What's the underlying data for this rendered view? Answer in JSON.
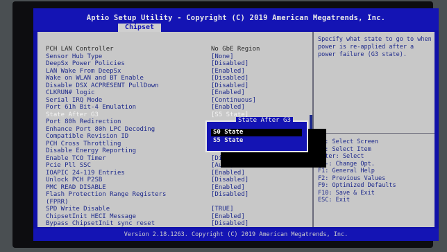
{
  "header": {
    "title": "Aptio Setup Utility - Copyright (C) 2019 American Megatrends, Inc.",
    "tab": "Chipset"
  },
  "settings": [
    {
      "label": "PCH LAN Controller",
      "value": "No GbE Region",
      "style": "dark"
    },
    {
      "label": "Sensor Hub Type",
      "value": "[None]",
      "style": "blue"
    },
    {
      "label": "DeepSx Power Policies",
      "value": "[Disabled]",
      "style": "blue"
    },
    {
      "label": "LAN Wake From DeepSx",
      "value": "[Enabled]",
      "style": "blue"
    },
    {
      "label": "Wake on WLAN and BT Enable",
      "value": "[Disabled]",
      "style": "blue"
    },
    {
      "label": "Disable DSX ACPRESENT PullDown",
      "value": "[Disabled]",
      "style": "blue"
    },
    {
      "label": "CLKRUN# logic",
      "value": "[Enabled]",
      "style": "blue"
    },
    {
      "label": "Serial IRQ Mode",
      "value": "[Continuous]",
      "style": "blue"
    },
    {
      "label": "Port 61h Bit-4 Emulation",
      "value": "[Enabled]",
      "style": "blue"
    },
    {
      "label": "State After G3",
      "value": "[S5 State]",
      "style": "white"
    },
    {
      "label": "Port 80h Redirection",
      "value": "",
      "style": "blue"
    },
    {
      "label": "Enhance Port 80h LPC Decoding",
      "value": "",
      "style": "blue"
    },
    {
      "label": "Compatible Revision ID",
      "value": "",
      "style": "blue"
    },
    {
      "label": "PCH Cross Throttling",
      "value": "",
      "style": "blue"
    },
    {
      "label": "Disable Energy Reporting",
      "value": "",
      "style": "blue"
    },
    {
      "label": "Enable TCO Timer",
      "value": "[Disabled]",
      "style": "blue"
    },
    {
      "label": "Pcie Pll SSC",
      "value": "[Auto]",
      "style": "blue"
    },
    {
      "label": "IOAPIC 24-119 Entries",
      "value": "[Enabled]",
      "style": "blue"
    },
    {
      "label": "Unlock PCH P2SB",
      "value": "[Disabled]",
      "style": "blue"
    },
    {
      "label": "PMC READ DISABLE",
      "value": "[Enabled]",
      "style": "blue"
    },
    {
      "label": "Flash Protection Range Registers",
      "value": "[Disabled]",
      "style": "blue"
    },
    {
      "label": "(FPRR)",
      "value": "",
      "style": "blue"
    },
    {
      "label": "SPD Write Disable",
      "value": "[TRUE]",
      "style": "blue"
    },
    {
      "label": "ChipsetInit HECI Message",
      "value": "[Enabled]",
      "style": "blue"
    },
    {
      "label": "Bypass ChipsetInit sync reset",
      "value": "[Disabled]",
      "style": "blue"
    }
  ],
  "help_text": "Specify what state to go to when power is re-applied after a power failure (G3 state).",
  "keys": [
    "→←: Select Screen",
    "↑↓: Select Item",
    "Enter: Select",
    "+/-: Change Opt.",
    "F1: General Help",
    "F2: Previous Values",
    "F9: Optimized Defaults",
    "F10: Save & Exit",
    "ESC: Exit"
  ],
  "popup": {
    "title": "State After G3",
    "options": [
      "S0 State",
      "S5 State"
    ],
    "selected_index": 0
  },
  "footer": "Version 2.18.1263. Copyright (C) 2019 American Megatrends, Inc.",
  "colors": {
    "background": "#1010a8",
    "panel": "#c8c8c8",
    "text_blue": "#1e2a8c",
    "highlight": "#f4f4f4"
  }
}
